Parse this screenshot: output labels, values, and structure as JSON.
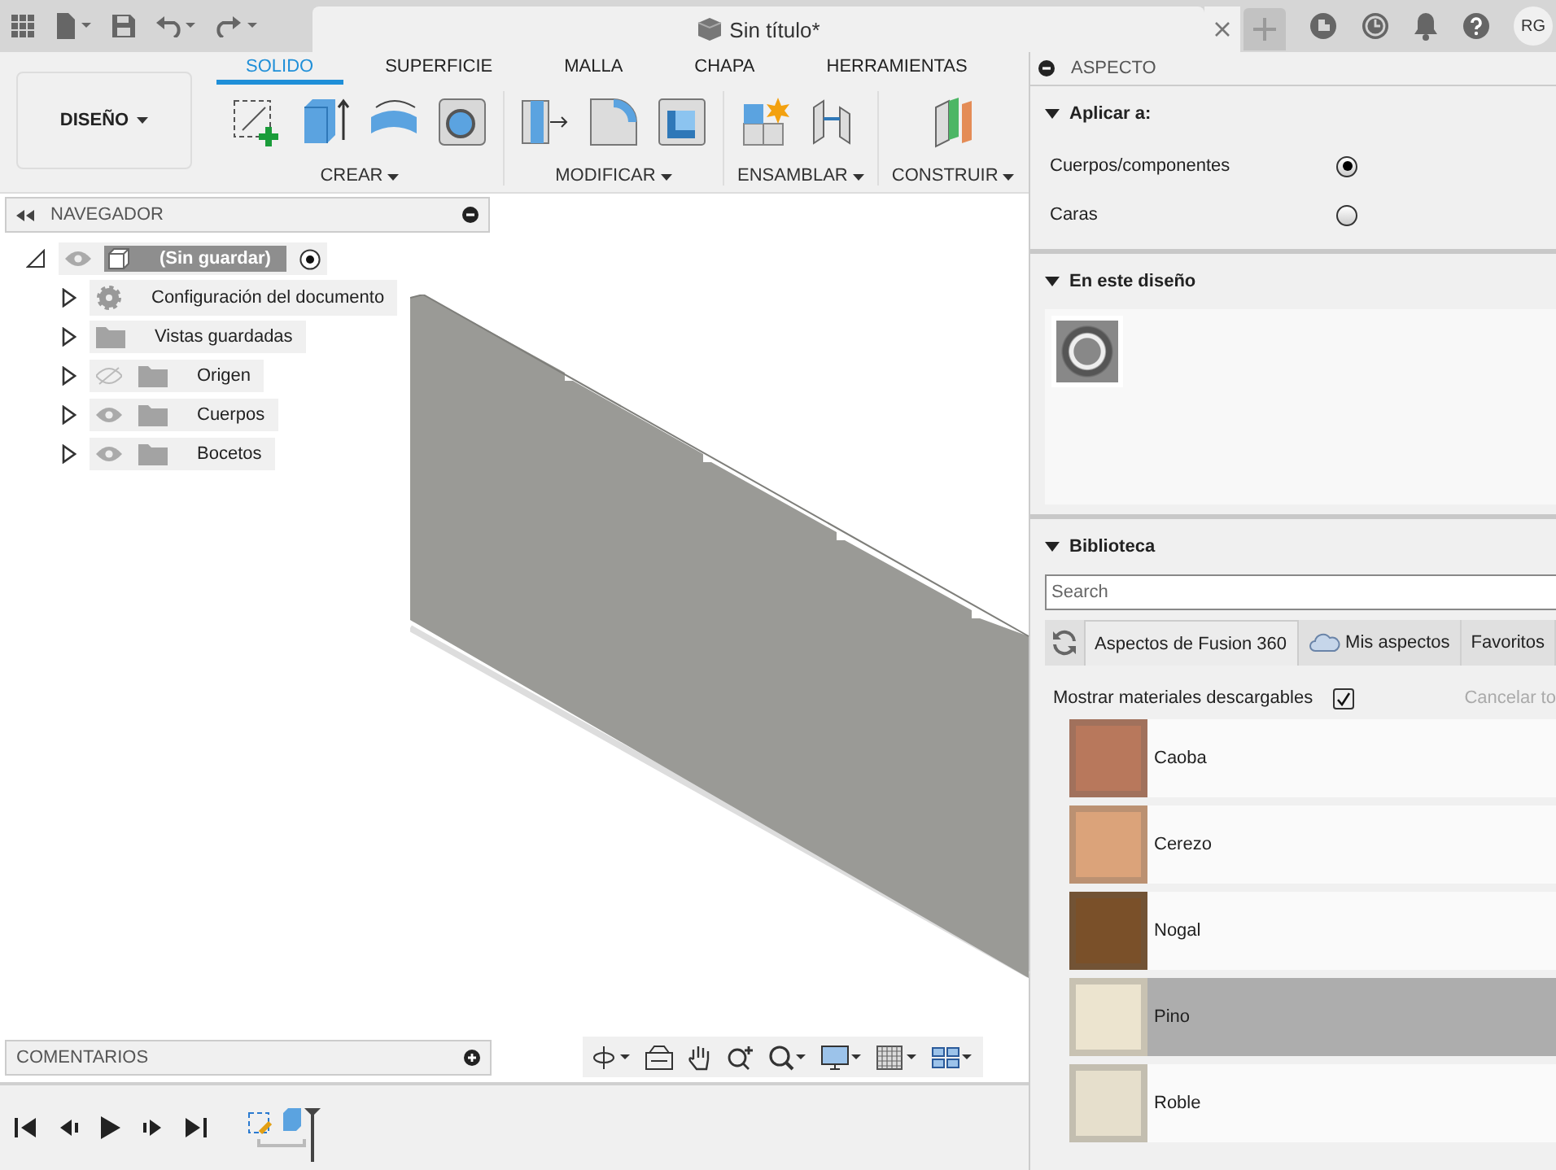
{
  "document": {
    "title": "Sin título*"
  },
  "user": {
    "initials": "RG"
  },
  "workspace": {
    "label": "DISEÑO"
  },
  "toolbar_tabs": [
    {
      "label": "SOLIDO",
      "selected": true
    },
    {
      "label": "SUPERFICIE",
      "selected": false
    },
    {
      "label": "MALLA",
      "selected": false
    },
    {
      "label": "CHAPA",
      "selected": false
    },
    {
      "label": "HERRAMIENTAS",
      "selected": false
    }
  ],
  "tool_groups": [
    {
      "label": "CREAR"
    },
    {
      "label": "MODIFICAR"
    },
    {
      "label": "ENSAMBLAR"
    },
    {
      "label": "CONSTRUIR"
    }
  ],
  "navigator": {
    "title": "NAVEGADOR",
    "root": {
      "label": "(Sin guardar)",
      "children": [
        {
          "label": "Configuración del documento",
          "kind": "settings"
        },
        {
          "label": "Vistas guardadas",
          "kind": "views"
        },
        {
          "label": "Origen",
          "kind": "folder",
          "visible": false
        },
        {
          "label": "Cuerpos",
          "kind": "folder",
          "visible": true
        },
        {
          "label": "Bocetos",
          "kind": "folder",
          "visible": true
        }
      ]
    }
  },
  "comments": {
    "title": "COMENTARIOS"
  },
  "appearance": {
    "title": "ASPECTO",
    "apply_to": {
      "heading": "Aplicar a:",
      "options": [
        {
          "label": "Cuerpos/componentes",
          "selected": true
        },
        {
          "label": "Caras",
          "selected": false
        }
      ]
    },
    "in_design": {
      "heading": "En este diseño"
    },
    "library": {
      "heading": "Biblioteca",
      "search": {
        "placeholder": "Search"
      },
      "tabs": [
        {
          "label": "Aspectos de Fusion 360",
          "selected": true
        },
        {
          "label": "Mis aspectos",
          "selected": false
        },
        {
          "label": "Favoritos",
          "selected": false
        }
      ],
      "downloadable": {
        "label": "Mostrar materiales descargables",
        "checked": true
      },
      "cancel_label": "Cancelar to",
      "materials": [
        {
          "name": "Caoba",
          "selected": false,
          "color": "#b8785c"
        },
        {
          "name": "Cerezo",
          "selected": false,
          "color": "#dba37a"
        },
        {
          "name": "Nogal",
          "selected": false,
          "color": "#7a5029"
        },
        {
          "name": "Pino",
          "selected": true,
          "color": "#ece4cf"
        },
        {
          "name": "Roble",
          "selected": false,
          "color": "#e6dfcc"
        }
      ]
    }
  }
}
